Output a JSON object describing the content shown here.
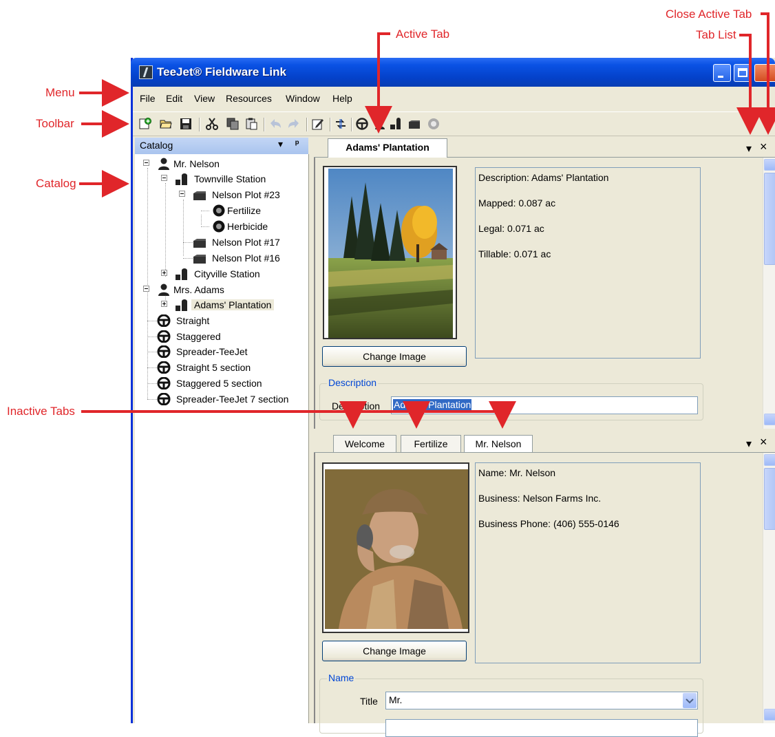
{
  "callouts": {
    "menu": "Menu",
    "toolbar": "Toolbar",
    "catalog": "Catalog",
    "inactive_tabs": "Inactive Tabs",
    "active_tab": "Active Tab",
    "close_active_tab": "Close Active Tab",
    "tab_list": "Tab List"
  },
  "colors": {
    "callout": "#e0262a",
    "titlebar": "#0a52e4",
    "group_title": "#0046d5",
    "selection": "#316ac5"
  },
  "window": {
    "title": "TeeJet® Fieldware Link"
  },
  "menu": [
    "File",
    "Edit",
    "View",
    "Resources",
    "Window",
    "Help"
  ],
  "toolbar_icons": [
    "new-icon",
    "open-icon",
    "save-icon",
    "cut-icon",
    "copy-icon",
    "paste-icon",
    "undo-icon",
    "redo-icon",
    "edit-icon",
    "transfer-icon",
    "steering-icon",
    "customer-icon",
    "farm-icon",
    "field-icon",
    "job-icon"
  ],
  "catalog": {
    "title": "Catalog",
    "tree": [
      {
        "label": "Mr. Nelson"
      },
      {
        "label": "Townville Station"
      },
      {
        "label": "Nelson Plot #23"
      },
      {
        "label": "Fertilize"
      },
      {
        "label": "Herbicide"
      },
      {
        "label": "Nelson Plot #17"
      },
      {
        "label": "Nelson Plot #16"
      },
      {
        "label": "Cityville Station"
      },
      {
        "label": "Mrs. Adams"
      },
      {
        "label": "Adams' Plantation"
      },
      {
        "label": "Straight"
      },
      {
        "label": "Staggered"
      },
      {
        "label": "Spreader-TeeJet"
      },
      {
        "label": "Straight 5 section"
      },
      {
        "label": "Staggered 5 section"
      },
      {
        "label": "Spreader-TeeJet 7 section"
      }
    ]
  },
  "pane_top": {
    "tab": "Adams' Plantation",
    "tab_list_glyph": "▾",
    "close_glyph": "×",
    "info": {
      "description": "Description: Adams' Plantation",
      "mapped": "Mapped: 0.087 ac",
      "legal": "Legal: 0.071 ac",
      "tillable": "Tillable: 0.071 ac"
    },
    "change_image": "Change Image",
    "group_title": "Description",
    "description_label": "Description",
    "description_value": "Adams' Plantation"
  },
  "pane_bottom": {
    "tabs": [
      "Welcome",
      "Fertilize",
      "Mr. Nelson"
    ],
    "tab_list_glyph": "▾",
    "close_glyph": "×",
    "info": {
      "name": "Name: Mr. Nelson",
      "business": "Business: Nelson Farms Inc.",
      "phone": "Business Phone: (406) 555-0146"
    },
    "change_image": "Change Image",
    "group_title": "Name",
    "title_label": "Title",
    "title_value": "Mr."
  }
}
